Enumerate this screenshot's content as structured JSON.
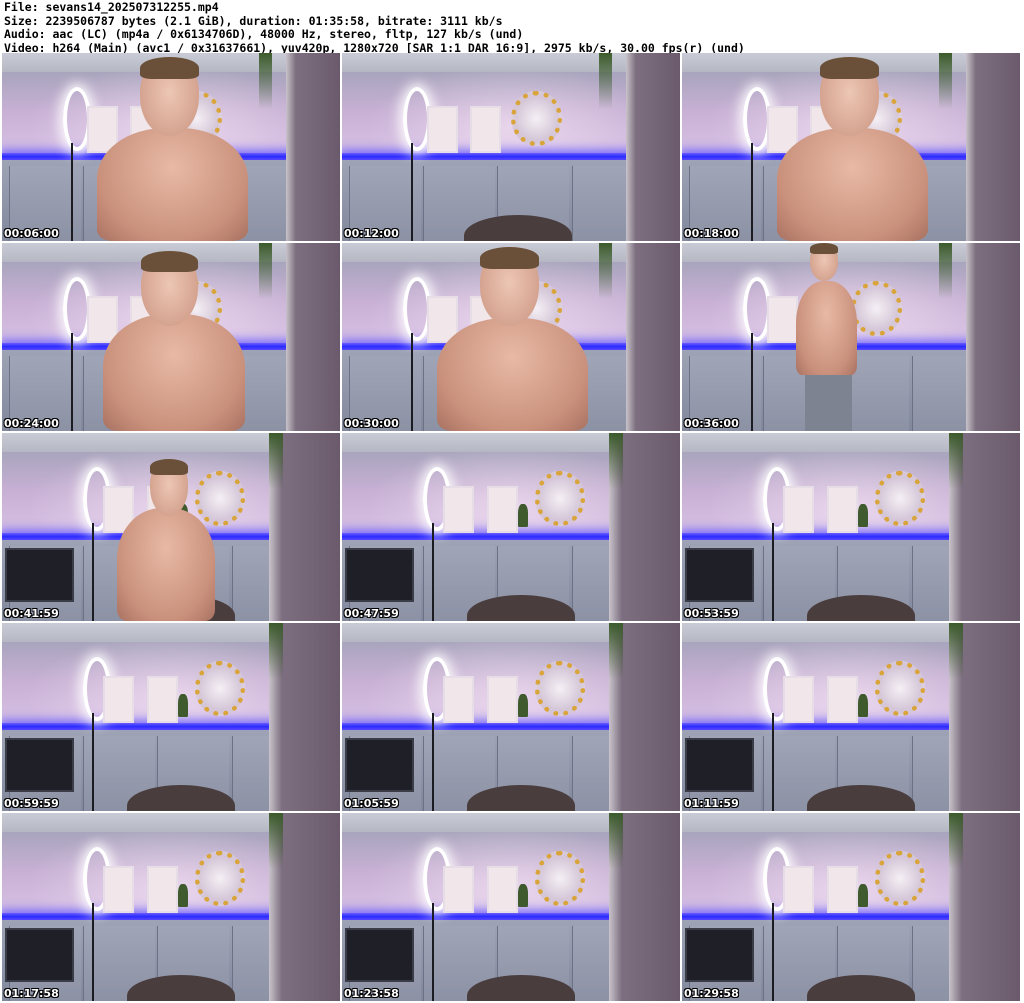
{
  "header": {
    "file": "File: sevans14_20250731225​5.mp4",
    "size": "Size: 2239506787 bytes (2.1 GiB), duration: 01:35:58, bitrate: 3111 kb/s",
    "audio": "Audio: aac (LC) (mp4a / 0x6134706D), 48000 Hz, stereo, fltp, 127 kb/s (und)",
    "video": "Video: h264 (Main) (avc1 / 0x31637661), yuv420p, 1280x720 [SAR 1:1 DAR 16:9], 2975 kb/s, 30.00 fps(r) (und)"
  },
  "thumbnails": [
    {
      "time": "00:06:00",
      "scene": "close",
      "person": "center"
    },
    {
      "time": "00:12:00",
      "scene": "close",
      "person": "none"
    },
    {
      "time": "00:18:00",
      "scene": "close",
      "person": "center"
    },
    {
      "time": "00:24:00",
      "scene": "close",
      "person": "left"
    },
    {
      "time": "00:30:00",
      "scene": "close",
      "person": "center"
    },
    {
      "time": "00:36:00",
      "scene": "close",
      "person": "standing"
    },
    {
      "time": "00:41:59",
      "scene": "wide",
      "person": "left"
    },
    {
      "time": "00:47:59",
      "scene": "wide",
      "person": "none"
    },
    {
      "time": "00:53:59",
      "scene": "wide",
      "person": "none"
    },
    {
      "time": "00:59:59",
      "scene": "wide",
      "person": "none"
    },
    {
      "time": "01:05:59",
      "scene": "wide",
      "person": "none"
    },
    {
      "time": "01:11:59",
      "scene": "wide",
      "person": "none"
    },
    {
      "time": "01:17:58",
      "scene": "wide",
      "person": "none"
    },
    {
      "time": "01:23:58",
      "scene": "wide",
      "person": "none"
    },
    {
      "time": "01:29:58",
      "scene": "wide",
      "person": "none"
    }
  ]
}
